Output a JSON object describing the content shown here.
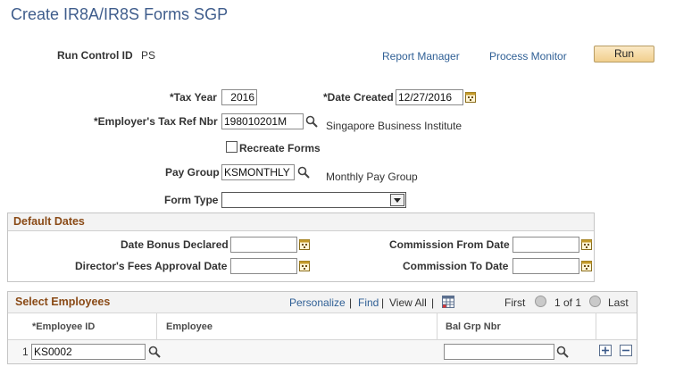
{
  "page": {
    "title": "Create IR8A/IR8S Forms SGP"
  },
  "run_control": {
    "label": "Run Control ID",
    "value": "PS",
    "report_manager": "Report Manager",
    "process_monitor": "Process Monitor",
    "run_label": "Run"
  },
  "form": {
    "tax_year_label": "*Tax Year",
    "tax_year_value": "2016",
    "date_created_label": "*Date Created",
    "date_created_value": "12/27/2016",
    "tax_ref_label": "*Employer's Tax Ref Nbr",
    "tax_ref_value": "198010201M",
    "tax_ref_desc": "Singapore Business Institute",
    "recreate_label": "Recreate Forms",
    "recreate_checked": false,
    "pay_group_label": "Pay Group",
    "pay_group_value": "KSMONTHLY",
    "pay_group_desc": "Monthly Pay Group",
    "form_type_label": "Form Type",
    "form_type_value": ""
  },
  "default_dates": {
    "title": "Default Dates",
    "bonus_label": "Date Bonus Declared",
    "bonus_value": "",
    "directors_label": "Director's Fees Approval Date",
    "directors_value": "",
    "comm_from_label": "Commission From Date",
    "comm_from_value": "",
    "comm_to_label": "Commission To Date",
    "comm_to_value": ""
  },
  "select_employees": {
    "title": "Select Employees",
    "personalize": "Personalize",
    "find": "Find",
    "view_all": "View All",
    "sep": "|",
    "first": "First",
    "range": "1 of 1",
    "last": "Last",
    "columns": [
      "*Employee ID",
      "Employee",
      "Bal Grp Nbr"
    ],
    "rows": [
      {
        "num": "1",
        "employee_id": "KS0002",
        "employee": "",
        "bal_grp_nbr": ""
      }
    ]
  },
  "icons": {
    "lookup": "magnifier-icon",
    "calendar": "calendar-icon",
    "grid_download": "grid-icon",
    "add_row": "plus-icon",
    "delete_row": "minus-icon"
  },
  "colors": {
    "title": "#3f5d8c",
    "link": "#2f5f95",
    "section_title": "#8a4a16",
    "run_button": "#f1cf8d"
  }
}
